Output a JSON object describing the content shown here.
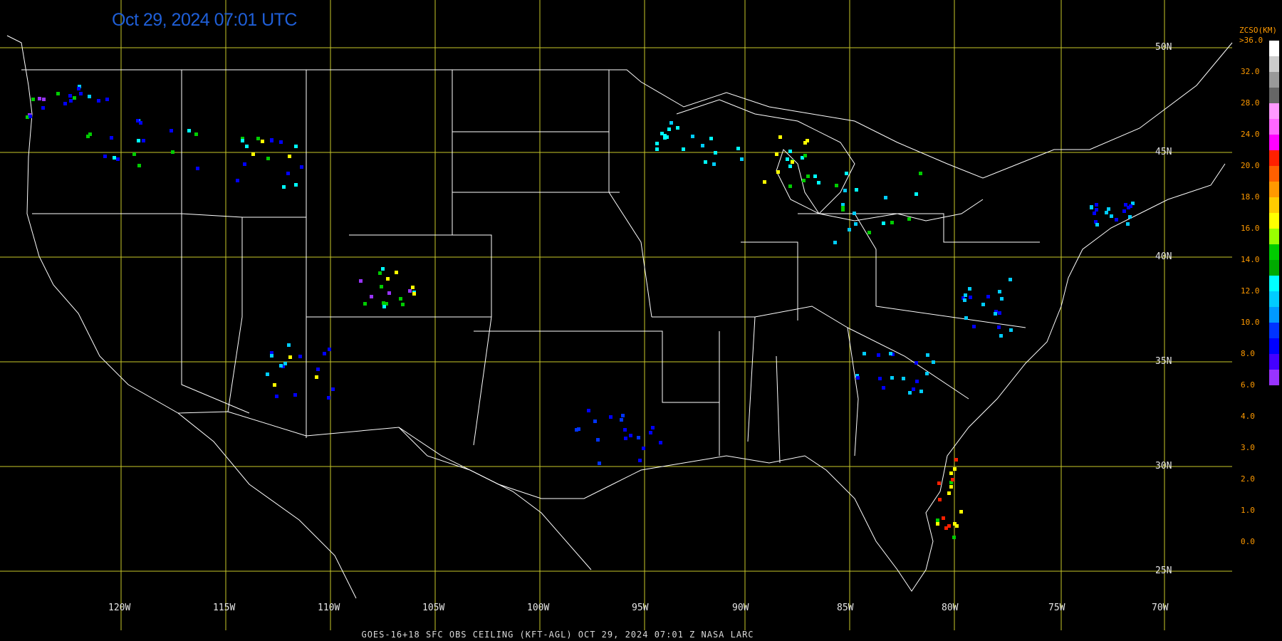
{
  "timestamp": "Oct 29, 2024 07:01 UTC",
  "footer": "GOES-16+18  SFC OBS CEILING (KFT-AGL)  OCT 29, 2024 07:01 Z  NASA LARC",
  "lat_labels": [
    "50N",
    "45N",
    "40N",
    "35N",
    "30N",
    "25N"
  ],
  "lon_labels": [
    "120W",
    "115W",
    "110W",
    "105W",
    "100W",
    "95W",
    "90W",
    "85W",
    "80W",
    "75W",
    "70W"
  ],
  "legend": {
    "title": "ZCSO(KM)",
    "top_label": ">36.0",
    "values": [
      "32.0",
      "28.0",
      "24.0",
      "20.0",
      "18.0",
      "16.0",
      "14.0",
      "12.0",
      "10.0",
      "8.0",
      "6.0",
      "4.0",
      "3.0",
      "2.0",
      "1.0",
      "0.0"
    ],
    "colors": [
      "#ffffff",
      "#cccccc",
      "#999999",
      "#666666",
      "#ff99ff",
      "#ff66ff",
      "#ff00ff",
      "#ff2000",
      "#ff6000",
      "#ff9900",
      "#ffcc00",
      "#ffff00",
      "#99ff00",
      "#00cc00",
      "#00aa00",
      "#00ffff",
      "#00ccff",
      "#0099ff",
      "#0033ff",
      "#0000ff",
      "#4400ff",
      "#9933ff"
    ]
  },
  "colors": {
    "grid": "#c8c82a",
    "borders": "#ffffff",
    "background": "#000000"
  }
}
